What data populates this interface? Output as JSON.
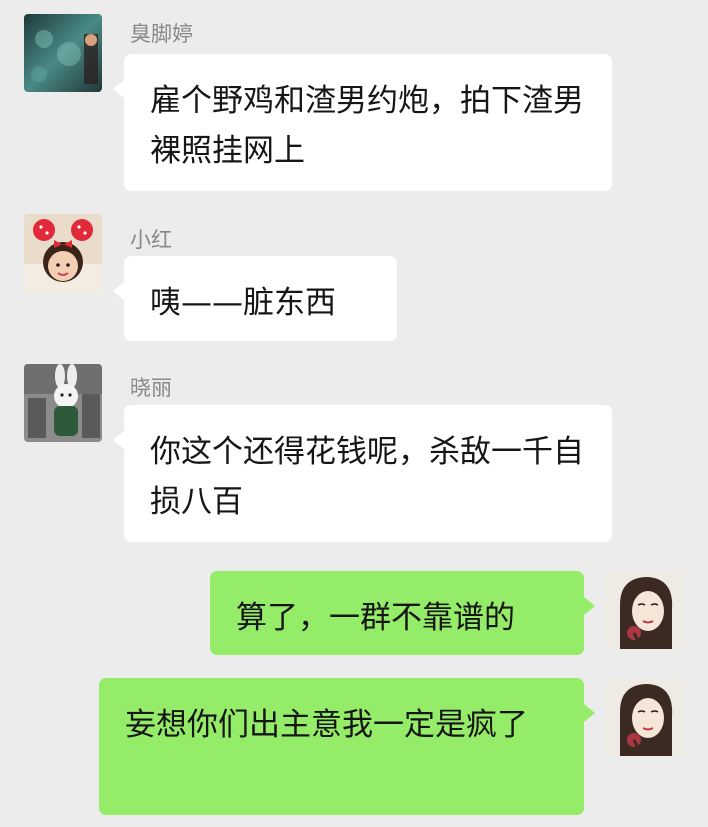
{
  "messages": [
    {
      "sender": "臭脚婷",
      "text": "雇个野鸡和渣男约炮，拍下渣男裸照挂网上",
      "direction": "in",
      "avatar": "ocean-avatar-icon"
    },
    {
      "sender": "小红",
      "text": "咦——脏东西",
      "direction": "in",
      "avatar": "girl-minnie-avatar-icon"
    },
    {
      "sender": "晓丽",
      "text": "你这个还得花钱呢，杀敌一千自损八百",
      "direction": "in",
      "avatar": "rabbit-doll-avatar-icon"
    },
    {
      "sender": "",
      "text": "算了，一群不靠谱的",
      "direction": "out",
      "avatar": "woman-sketch-avatar-icon"
    },
    {
      "sender": "",
      "text": "妄想你们出主意我一定是疯了",
      "direction": "out",
      "avatar": "woman-sketch-avatar-icon"
    }
  ],
  "colors": {
    "background": "#ececec",
    "incoming_bubble": "#ffffff",
    "outgoing_bubble": "#95ec69",
    "sender_name": "#888888"
  }
}
